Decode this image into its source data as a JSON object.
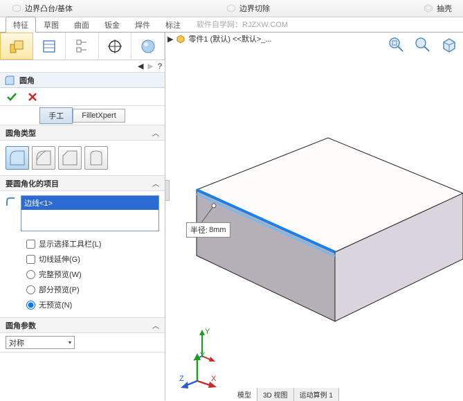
{
  "top": {
    "bossbase": "边界凸台/基体",
    "cut": "边界切除",
    "shell": "抽壳"
  },
  "tabs": {
    "feature": "特征",
    "sketch": "草图",
    "surface": "曲面",
    "sheetmetal": "钣金",
    "weldment": "焊件",
    "annotate": "标注"
  },
  "watermark": "软件自学网：RJZXW.COM",
  "breadcrumb": {
    "arrow": "▶",
    "part": "零件1 (默认) <<默认>_..."
  },
  "feature": {
    "name": "圆角",
    "ok": "✓",
    "cancel": "✕"
  },
  "mode": {
    "manual": "手工",
    "xpert": "FilletXpert"
  },
  "sections": {
    "type": "圆角类型",
    "items": "要圆角化的项目",
    "params": "圆角参数"
  },
  "selected": {
    "edge": "边线<1>"
  },
  "opts": {
    "showbar": "显示选择工具栏(L)",
    "tangent": "切线延伸(G)",
    "fullprev": "完整预览(W)",
    "partprev": "部分预览(P)",
    "noprev": "无预览(N)"
  },
  "params": {
    "symmetric": "对称"
  },
  "annot": {
    "label": "半径:",
    "value": "8mm"
  },
  "btabs": {
    "model": "模型",
    "view3d": "3D 视图",
    "motion": "运动算例 1"
  },
  "arrows": {
    "l": "◀",
    "r": "▶",
    "q": "?"
  }
}
